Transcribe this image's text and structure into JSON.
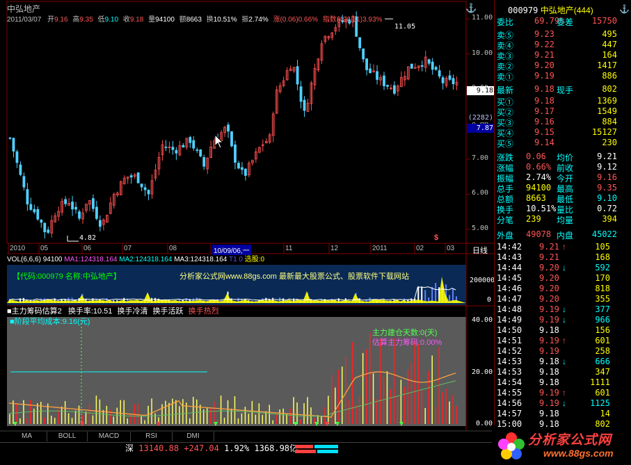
{
  "chart_header": {
    "title": "中弘地产",
    "date": "2011/03/07",
    "open_label": "开",
    "open": "9.16",
    "high_label": "高",
    "high": "9.35",
    "low_label": "低",
    "low": "9.10",
    "close_label": "收",
    "close": "9.18",
    "vol_label": "量",
    "vol": "94100",
    "amt_label": "额",
    "amt": "8663",
    "turn_label": "换",
    "turn": "10.51%",
    "amp_label": "振",
    "amp": "2.74%",
    "chg_label": "涨",
    "chg": "(0.06)0.66%",
    "idx_label": "指数",
    "idx": "(496.31)3.93%"
  },
  "price_axis": [
    "11.00",
    "10.00",
    "9.00",
    "8.00",
    "7.00",
    "6.00",
    "5.00"
  ],
  "price_marks": {
    "high": "11.05",
    "low": "4.82",
    "current": "9.18",
    "box1": "(2282)",
    "box2": "7.87"
  },
  "date_axis": [
    "2010",
    "05",
    "06",
    "07",
    "08",
    "10/09/06,一",
    "11",
    "12",
    "2011",
    "02",
    "03"
  ],
  "date_axis_right": "日线",
  "vol_header": {
    "vol": "VOL(6,6,6) 94100",
    "ma1": "MA1:124318.164",
    "ma2": "MA2:124318.164",
    "ma3": "MA3:124318.164",
    "t1": "T1 0",
    "xg": "选股:0"
  },
  "vol_axis": [
    "200000",
    "0"
  ],
  "banner": {
    "code": "【代码:000979 名称:中弘地产】",
    "site": "分析家公式网www.88gs.com 最新最大股票公式、股票软件下载网站"
  },
  "ind_header": {
    "name": "■主力筹码估算2",
    "r1": "换手率:10.51",
    "r2": "换手冷清",
    "r3": "换手活跃",
    "r4": "换手热烈"
  },
  "ind_line2": "■阶段平均成本:9.16(元)",
  "ind_text1": "主力建仓天数:0(天)",
  "ind_text2": "估算主力筹码:0.00%",
  "ind_axis": [
    "40.00",
    "20.00",
    "0.00"
  ],
  "tabs": [
    "MA",
    "BOLL",
    "MACD",
    "RSI",
    "DMI"
  ],
  "status": {
    "market": "深",
    "index": "13140.88",
    "change": "+247.04",
    "pct": "1.92%",
    "amount": "1368.98亿"
  },
  "logo": {
    "main": "分析家公式网",
    "url": "www.88gs.com"
  },
  "quote": {
    "code": "000979",
    "name": "中弘地产",
    "num": "(444)",
    "wb_label": "委比",
    "wb": "69.79%",
    "wc_label": "委差",
    "wc": "15750",
    "sells": [
      {
        "l": "卖⑤",
        "p": "9.23",
        "v": "495"
      },
      {
        "l": "卖④",
        "p": "9.22",
        "v": "447"
      },
      {
        "l": "卖③",
        "p": "9.21",
        "v": "164"
      },
      {
        "l": "卖②",
        "p": "9.20",
        "v": "1417"
      },
      {
        "l": "卖①",
        "p": "9.19",
        "v": "886"
      }
    ],
    "last_label": "最新",
    "last": "9.18",
    "hand_label": "现手",
    "hand": "802",
    "buys": [
      {
        "l": "买①",
        "p": "9.18",
        "v": "1369"
      },
      {
        "l": "买②",
        "p": "9.17",
        "v": "1549"
      },
      {
        "l": "买③",
        "p": "9.16",
        "v": "884"
      },
      {
        "l": "买④",
        "p": "9.15",
        "v": "15127"
      },
      {
        "l": "买⑤",
        "p": "9.14",
        "v": "230"
      }
    ],
    "stats": [
      {
        "l": "涨跌",
        "v": "0.06",
        "l2": "均价",
        "v2": "9.21"
      },
      {
        "l": "涨幅",
        "v": "0.66%",
        "l2": "前收",
        "v2": "9.12"
      },
      {
        "l": "振幅",
        "v": "2.74%",
        "l2": "今开",
        "v2": "9.16"
      },
      {
        "l": "总手",
        "v": "94100",
        "l2": "最高",
        "v2": "9.35"
      },
      {
        "l": "总额",
        "v": "8663",
        "l2": "最低",
        "v2": "9.10"
      },
      {
        "l": "换手",
        "v": "10.51%",
        "l2": "量比",
        "v2": "0.72"
      },
      {
        "l": "分笔",
        "v": "239",
        "l2": "均量",
        "v2": "394"
      }
    ],
    "outer_label": "外盘",
    "outer": "49078",
    "inner_label": "内盘",
    "inner": "45022"
  },
  "ticks": [
    {
      "t": "14:42",
      "p": "9.21",
      "a": "↑",
      "v": "105"
    },
    {
      "t": "14:43",
      "p": "9.21",
      "a": "",
      "v": "168"
    },
    {
      "t": "14:44",
      "p": "9.20",
      "a": "↓",
      "v": "592"
    },
    {
      "t": "14:45",
      "p": "9.20",
      "a": "",
      "v": "170"
    },
    {
      "t": "14:46",
      "p": "9.20",
      "a": "",
      "v": "818"
    },
    {
      "t": "14:47",
      "p": "9.20",
      "a": "",
      "v": "355"
    },
    {
      "t": "14:48",
      "p": "9.19",
      "a": "↓",
      "v": "377"
    },
    {
      "t": "14:49",
      "p": "9.19",
      "a": "↓",
      "v": "966"
    },
    {
      "t": "14:50",
      "p": "9.18",
      "a": "",
      "v": "156"
    },
    {
      "t": "14:51",
      "p": "9.19",
      "a": "↑",
      "v": "601"
    },
    {
      "t": "14:52",
      "p": "9.19",
      "a": "",
      "v": "258"
    },
    {
      "t": "14:53",
      "p": "9.18",
      "a": "↓",
      "v": "666"
    },
    {
      "t": "14:53",
      "p": "9.18",
      "a": "",
      "v": "347"
    },
    {
      "t": "14:54",
      "p": "9.18",
      "a": "",
      "v": "1111"
    },
    {
      "t": "14:55",
      "p": "9.19",
      "a": "↑",
      "v": "601"
    },
    {
      "t": "14:56",
      "p": "9.19",
      "a": "↓",
      "v": "1125"
    },
    {
      "t": "14:57",
      "p": "9.18",
      "a": "",
      "v": "14"
    },
    {
      "t": "15:00",
      "p": "9.18",
      "a": "",
      "v": "802"
    }
  ],
  "colors": {
    "up": "#ff5050",
    "down": "#50d0ff",
    "vol": "#ffff00",
    "ma": "#ffffff"
  }
}
